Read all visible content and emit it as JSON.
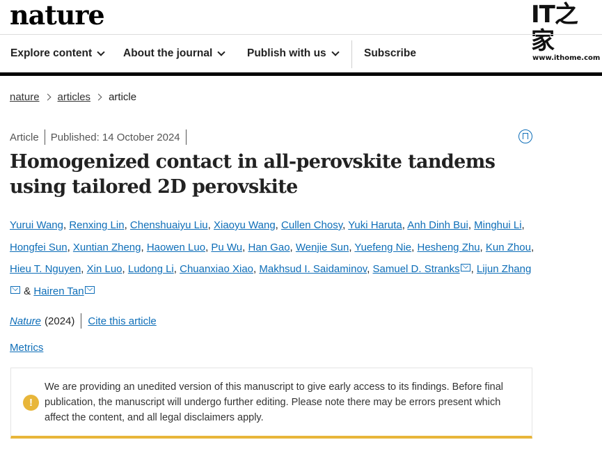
{
  "brand": {
    "logo": "nature"
  },
  "watermark": {
    "mark": "IT之家",
    "url": "www.ithome.com"
  },
  "nav": {
    "items": [
      {
        "label": "Explore content",
        "dropdown": true
      },
      {
        "label": "About the journal",
        "dropdown": true
      },
      {
        "label": "Publish with us",
        "dropdown": true
      },
      {
        "label": "Subscribe",
        "dropdown": false
      }
    ]
  },
  "breadcrumb": {
    "items": [
      "nature",
      "articles"
    ],
    "current": "article"
  },
  "article": {
    "type": "Article",
    "published": "Published: 14 October 2024",
    "title": "Homogenized contact in all-perovskite tandems using tailored 2D perovskite",
    "authors": [
      "Yurui Wang",
      "Renxing Lin",
      "Chenshuaiyu Liu",
      "Xiaoyu Wang",
      "Cullen Chosy",
      "Yuki Haruta",
      "Anh Dinh Bui",
      "Minghui Li",
      "Hongfei Sun",
      "Xuntian Zheng",
      "Haowen Luo",
      "Pu Wu",
      "Han Gao",
      "Wenjie Sun",
      "Yuefeng Nie",
      "Hesheng Zhu",
      "Kun Zhou",
      "Hieu T. Nguyen",
      "Xin Luo",
      "Ludong Li",
      "Chuanxiao Xiao",
      "Makhsud I. Saidaminov",
      "Samuel D. Stranks",
      "Lijun Zhang",
      "Hairen Tan"
    ],
    "journal": "Nature",
    "year": "(2024)",
    "cite_label": "Cite this article",
    "metrics_label": "Metrics"
  },
  "notice": {
    "text": "We are providing an unedited version of this manuscript to give early access to its findings. Before final publication, the manuscript will undergo further editing. Please note there may be errors present which affect the content, and all legal disclaimers apply.",
    "icon": "warning-icon",
    "accent": "#e8b63a"
  },
  "colors": {
    "link": "#0e6eb8",
    "text": "#222222",
    "nav_bar": "#000000"
  }
}
